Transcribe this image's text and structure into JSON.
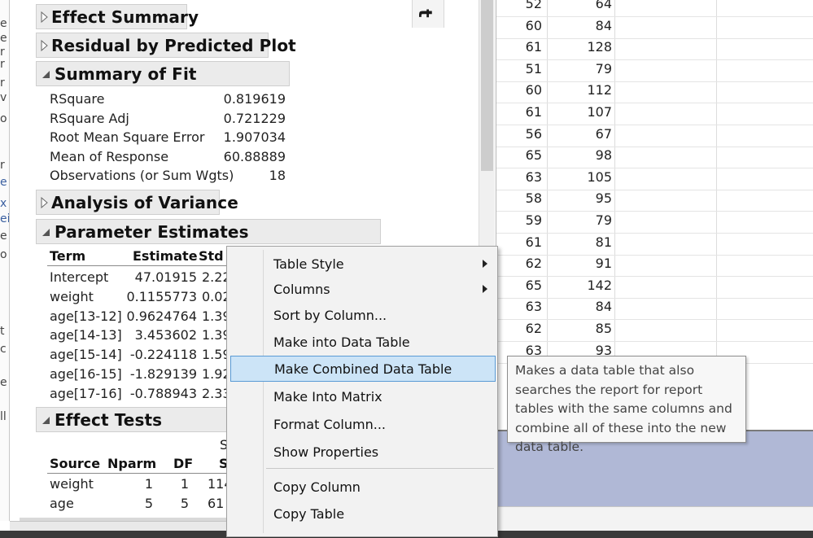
{
  "left_sliver_chars": [
    "e",
    "e",
    "r",
    "r",
    "r",
    "v",
    "o",
    "r",
    "e",
    "x",
    "ei",
    "e",
    "o",
    "t",
    "c",
    "e",
    "ll"
  ],
  "report": {
    "vertical_label": "t",
    "sections": {
      "effect_summary": "Effect Summary",
      "residual_plot": "Residual by Predicted Plot",
      "summary_of_fit": "Summary of Fit",
      "analysis_of_variance": "Analysis of Variance",
      "parameter_estimates": "Parameter Estimates",
      "effect_tests": "Effect Tests"
    },
    "summary_of_fit_rows": [
      {
        "label": "RSquare",
        "value": "0.819619"
      },
      {
        "label": "RSquare Adj",
        "value": "0.721229"
      },
      {
        "label": "Root Mean Square Error",
        "value": "1.907034"
      },
      {
        "label": "Mean of Response",
        "value": "60.88889"
      },
      {
        "label": "Observations (or Sum Wgts)",
        "value": "18"
      }
    ],
    "parameter_estimates": {
      "headers": {
        "term": "Term",
        "estimate": "Estimate",
        "std": "Std"
      },
      "rows": [
        {
          "term": "Intercept",
          "estimate": "47.01915",
          "std": "2.22"
        },
        {
          "term": "weight",
          "estimate": "0.1155773",
          "std": "0.02"
        },
        {
          "term": "age[13-12]",
          "estimate": "0.9624764",
          "std": "1.39"
        },
        {
          "term": "age[14-13]",
          "estimate": "3.453602",
          "std": "1.39"
        },
        {
          "term": "age[15-14]",
          "estimate": "-0.224118",
          "std": "1.59"
        },
        {
          "term": "age[16-15]",
          "estimate": "-1.829139",
          "std": "1.92"
        },
        {
          "term": "age[17-16]",
          "estimate": "-0.788943",
          "std": "2.33"
        }
      ]
    },
    "effect_tests": {
      "top_clipped": "S",
      "headers": {
        "source": "Source",
        "nparm": "Nparm",
        "df": "DF",
        "s": "S"
      },
      "rows": [
        {
          "source": "weight",
          "nparm": "1",
          "df": "1",
          "s": "114"
        },
        {
          "source": "age",
          "nparm": "5",
          "df": "5",
          "s": "61"
        }
      ]
    }
  },
  "grid": {
    "rows": [
      {
        "a": "52",
        "b": "64"
      },
      {
        "a": "60",
        "b": "84"
      },
      {
        "a": "61",
        "b": "128"
      },
      {
        "a": "51",
        "b": "79"
      },
      {
        "a": "60",
        "b": "112"
      },
      {
        "a": "61",
        "b": "107"
      },
      {
        "a": "56",
        "b": "67"
      },
      {
        "a": "65",
        "b": "98"
      },
      {
        "a": "63",
        "b": "105"
      },
      {
        "a": "58",
        "b": "95"
      },
      {
        "a": "59",
        "b": "79"
      },
      {
        "a": "61",
        "b": "81"
      },
      {
        "a": "62",
        "b": "91"
      },
      {
        "a": "65",
        "b": "142"
      },
      {
        "a": "63",
        "b": "84"
      },
      {
        "a": "62",
        "b": "85"
      },
      {
        "a": "63",
        "b": "93"
      }
    ]
  },
  "context_menu": {
    "items": [
      {
        "label": "Table Style",
        "submenu": true
      },
      {
        "label": "Columns",
        "submenu": true
      },
      {
        "label": "Sort by Column...",
        "submenu": false
      },
      {
        "label": "Make into Data Table",
        "submenu": false
      },
      {
        "label": "Make Combined Data Table",
        "submenu": false,
        "highlighted": true
      },
      {
        "label": "Make Into Matrix",
        "submenu": false
      },
      {
        "label": "Format Column...",
        "submenu": false
      },
      {
        "label": "Show Properties",
        "submenu": false
      },
      {
        "label": "Copy Column",
        "submenu": false
      },
      {
        "label": "Copy Table",
        "submenu": false
      }
    ]
  },
  "tooltip": {
    "text": "Makes a data table that also searches the report for report tables with the same columns and combine all of these into the new data table."
  },
  "colors": {
    "menu_highlight": "#cce4f7",
    "menu_highlight_border": "#5b9bd5",
    "blue_area": "#b0b8d6"
  }
}
